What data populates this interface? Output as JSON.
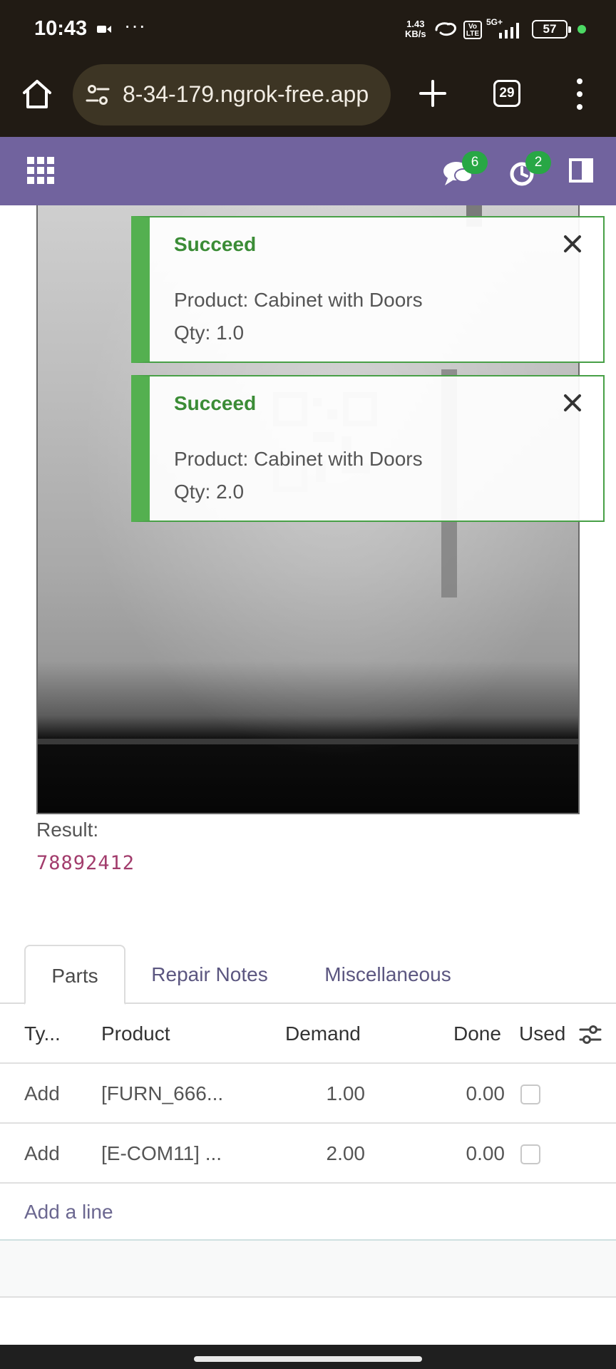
{
  "status_bar": {
    "time": "10:43",
    "more": "···",
    "speed_value": "1.43",
    "speed_unit": "KB/s",
    "volte": "Vo LTE",
    "network": "5G+",
    "battery": "57"
  },
  "browser": {
    "url": "8-34-179.ngrok-free.app",
    "tab_count": "29"
  },
  "nav": {
    "chat_count": "6",
    "activity_count": "2"
  },
  "toasts": [
    {
      "title": "Succeed",
      "product": "Product: Cabinet with Doors",
      "qty": "Qty: 1.0"
    },
    {
      "title": "Succeed",
      "product": "Product: Cabinet with Doors",
      "qty": "Qty: 2.0"
    }
  ],
  "result": {
    "label": "Result:",
    "value": "78892412"
  },
  "tabs": [
    "Parts",
    "Repair Notes",
    "Miscellaneous"
  ],
  "table": {
    "headers": {
      "type": "Ty...",
      "product": "Product",
      "demand": "Demand",
      "done": "Done",
      "used": "Used"
    },
    "rows": [
      {
        "type": "Add",
        "product": "[FURN_666...",
        "demand": "1.00",
        "done": "0.00",
        "used": false
      },
      {
        "type": "Add",
        "product": "[E-COM11] ...",
        "demand": "2.00",
        "done": "0.00",
        "used": false
      }
    ],
    "add_line": "Add a line"
  },
  "colors": {
    "nav": "#71639e",
    "success": "#54b050",
    "result_value": "#a23c6c",
    "badge": "#28a745"
  }
}
